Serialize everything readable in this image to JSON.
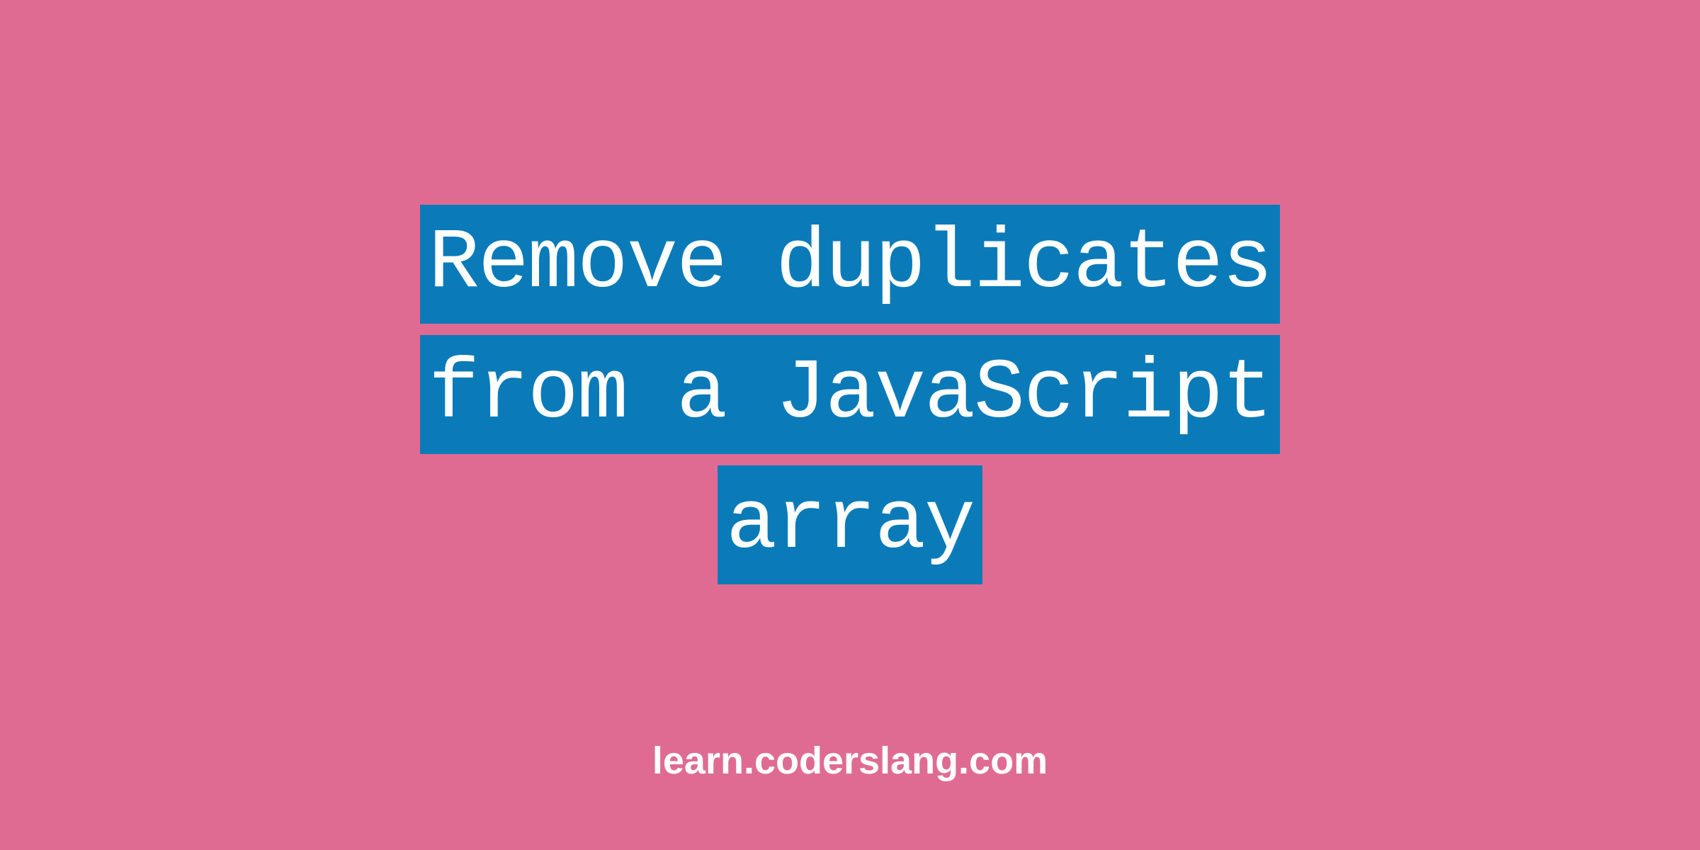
{
  "title": {
    "line1": "Remove duplicates",
    "line2": "from a JavaScript",
    "line3": "array"
  },
  "footer": {
    "text": "learn.coderslang.com"
  },
  "colors": {
    "background": "#df6b93",
    "highlight": "#0a7bb8",
    "text": "#ffffff"
  }
}
